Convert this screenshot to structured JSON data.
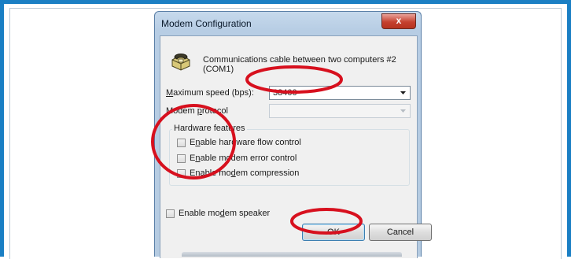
{
  "dialog": {
    "title": "Modem Configuration",
    "close_glyph": "x",
    "device_name": "Communications cable between two computers #2 (COM1)",
    "icon": "modem-icon"
  },
  "max_speed": {
    "label_pre": "",
    "label_accel": "M",
    "label_post": "aximum speed (bps):",
    "value": "38400"
  },
  "modem_protocol": {
    "label_pre": "Modem ",
    "label_accel": "p",
    "label_post": "rotocol",
    "value": ""
  },
  "hardware_features": {
    "label": "Hardware features",
    "items": [
      {
        "pre": "E",
        "accel": "n",
        "post": "able hardware flow control",
        "checked": false
      },
      {
        "pre": "E",
        "accel": "n",
        "post": "able modem error control",
        "checked": false
      },
      {
        "pre": "Enable mo",
        "accel": "d",
        "post": "em compression",
        "checked": false
      }
    ]
  },
  "speaker": {
    "pre": "Enable mo",
    "accel": "d",
    "post": "em speaker",
    "checked": false
  },
  "buttons": {
    "ok": "OK",
    "cancel": "Cancel"
  },
  "colors": {
    "frame_border": "#1a7fc4",
    "annotation_red": "#d7101e",
    "close_button": "#c5412f"
  }
}
